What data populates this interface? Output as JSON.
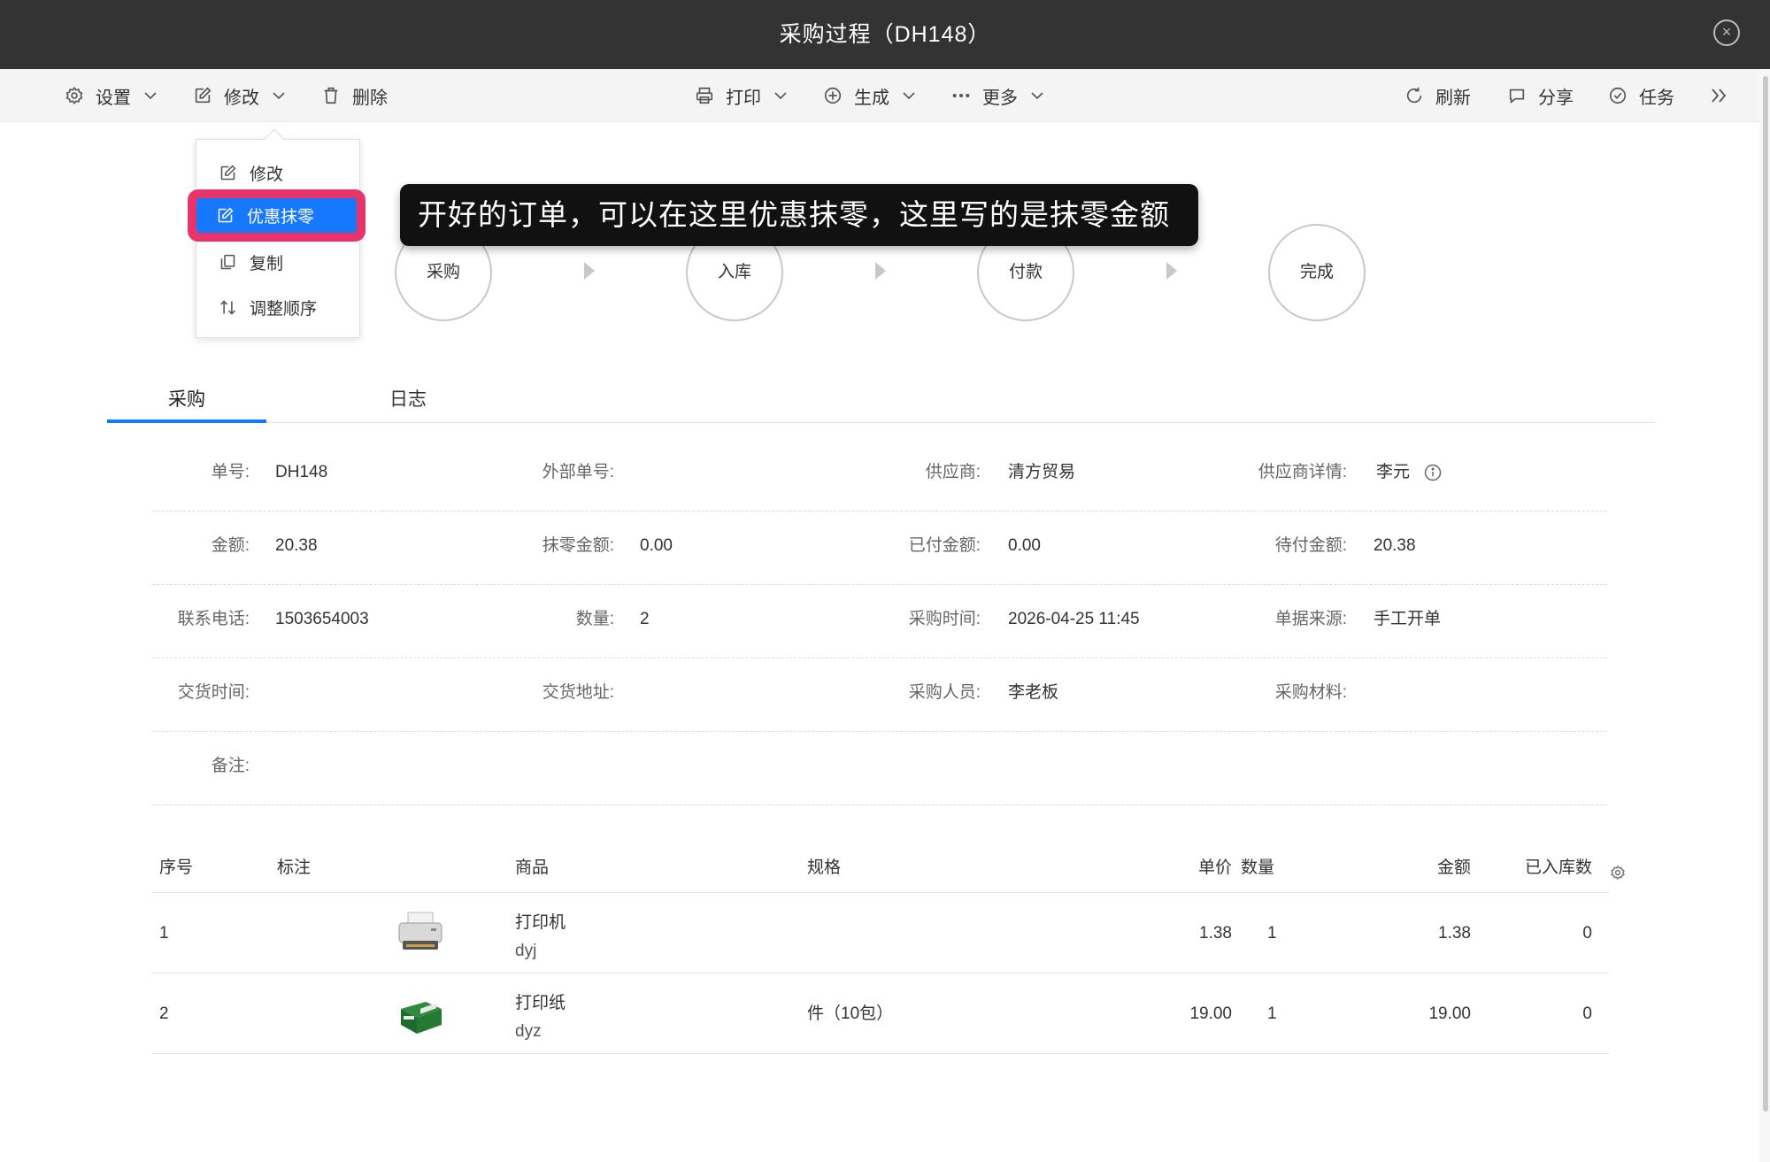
{
  "window": {
    "title": "采购过程（DH148）"
  },
  "toolbar": {
    "settings": "设置",
    "edit": "修改",
    "delete": "删除",
    "print": "打印",
    "generate": "生成",
    "more": "更多",
    "refresh": "刷新",
    "share": "分享",
    "task": "任务"
  },
  "dropdown": {
    "items": [
      {
        "label": "修改",
        "icon": "edit-icon"
      },
      {
        "label": "优惠抹零",
        "icon": "edit-icon",
        "selected": true
      },
      {
        "label": "复制",
        "icon": "copy-icon"
      },
      {
        "label": "调整顺序",
        "icon": "sort-icon"
      }
    ]
  },
  "tooltip": {
    "text": "开好的订单，可以在这里优惠抹零，这里写的是抹零金额"
  },
  "process": {
    "steps": [
      "采购",
      "入库",
      "付款",
      "完成"
    ]
  },
  "tabs": [
    {
      "label": "采购",
      "active": true
    },
    {
      "label": "日志",
      "active": false
    }
  ],
  "details": {
    "order_no": {
      "label": "单号:",
      "value": "DH148"
    },
    "ext_no": {
      "label": "外部单号:",
      "value": ""
    },
    "supplier": {
      "label": "供应商:",
      "value": "清方贸易"
    },
    "supplier_detail": {
      "label": "供应商详情:",
      "value": "李元"
    },
    "amount": {
      "label": "金额:",
      "value": "20.38"
    },
    "discount": {
      "label": "抹零金额:",
      "value": "0.00"
    },
    "paid": {
      "label": "已付金额:",
      "value": "0.00"
    },
    "unpaid": {
      "label": "待付金额:",
      "value": "20.38"
    },
    "phone": {
      "label": "联系电话:",
      "value": "1503654003"
    },
    "quantity": {
      "label": "数量:",
      "value": "2"
    },
    "purchase_time": {
      "label": "采购时间:",
      "value": "2026-04-25 11:45"
    },
    "source": {
      "label": "单据来源:",
      "value": "手工开单"
    },
    "delivery_time": {
      "label": "交货时间:",
      "value": ""
    },
    "delivery_addr": {
      "label": "交货地址:",
      "value": ""
    },
    "purchaser": {
      "label": "采购人员:",
      "value": "李老板"
    },
    "material": {
      "label": "采购材料:",
      "value": ""
    },
    "remark": {
      "label": "备注:",
      "value": ""
    }
  },
  "table": {
    "headers": [
      "序号",
      "标注",
      "商品",
      "规格",
      "单价",
      "数量",
      "金额",
      "已入库数"
    ],
    "rows": [
      {
        "no": "1",
        "image": "printer-image",
        "name": "打印机",
        "code": "dyj",
        "spec": "",
        "price": "1.38",
        "qty": "1",
        "amount": "1.38",
        "stocked": "0"
      },
      {
        "no": "2",
        "image": "paper-box-image",
        "name": "打印纸",
        "code": "dyz",
        "spec": "件（10包）",
        "price": "19.00",
        "qty": "1",
        "amount": "19.00",
        "stocked": "0"
      }
    ]
  },
  "colors": {
    "accent": "#1677ff",
    "highlight": "#e8336b",
    "titlebar": "#333333"
  }
}
